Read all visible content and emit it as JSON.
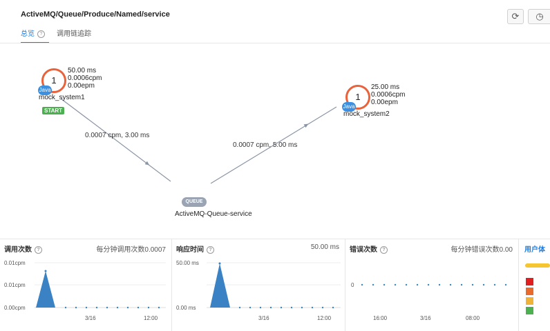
{
  "header": {
    "title": "ActiveMQ/Queue/Produce/Named/service",
    "refresh_icon": "refresh-icon",
    "time_icon": "clock-icon"
  },
  "tabs": [
    {
      "label": "总览",
      "active": true
    },
    {
      "label": "调用链追踪",
      "active": false
    }
  ],
  "topology": {
    "nodes": [
      {
        "id": "mock_system1",
        "count": "1",
        "lang": "Java",
        "name": "mock_system1",
        "stats": [
          "50.00 ms",
          "0.0006cpm",
          "0.00epm"
        ],
        "badge": "START"
      },
      {
        "id": "mock_system2",
        "count": "1",
        "lang": "Java",
        "name": "mock_system2",
        "stats": [
          "25.00 ms",
          "0.0006cpm",
          "0.00epm"
        ]
      },
      {
        "id": "queue",
        "type": "QUEUE",
        "name": "ActiveMQ-Queue-service"
      }
    ],
    "edges": [
      {
        "from": "mock_system1",
        "to": "queue",
        "label": "0.0007 cpm, 3.00 ms"
      },
      {
        "from": "queue",
        "to": "mock_system2",
        "label": "0.0007 cpm, 5.00 ms"
      }
    ]
  },
  "panels": {
    "calls": {
      "title": "调用次数",
      "summary": "每分钟调用次数0.0007",
      "y_ticks": [
        "0.01cpm",
        "0.01cpm",
        "0.00cpm"
      ],
      "x_ticks": [
        "3/16",
        "12:00"
      ]
    },
    "latency": {
      "title": "响应时间",
      "summary": "50.00 ms",
      "y_ticks": [
        "50.00 ms",
        "0.00 ms"
      ],
      "x_ticks": [
        "3/16",
        "12:00"
      ]
    },
    "errors": {
      "title": "错误次数",
      "summary": "每分钟错误次数0.00",
      "y_ticks": [
        "0"
      ],
      "x_ticks": [
        "16:00",
        "3/16",
        "08:00"
      ]
    },
    "user": {
      "title": "用户体",
      "legend_colors": [
        "#e02020",
        "#e86a2c",
        "#f0b33a",
        "#4caf50"
      ]
    }
  },
  "colors": {
    "accent": "#1d7ce0",
    "node_ring": "#e8623b",
    "java_badge": "#3d8fe0",
    "start_badge": "#4caf50",
    "chart_fill": "#3a82c4"
  }
}
